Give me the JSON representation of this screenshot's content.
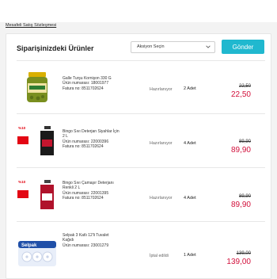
{
  "header": {
    "terms_link": "Mesafeli Satış Sözleşmesi"
  },
  "card": {
    "title": "Siparişinizdeki Ürünler",
    "action_select": {
      "value": "Aksiyon Seçin"
    },
    "send_button": "Gönder"
  },
  "items": [
    {
      "name": "Galle Turşu Kornişon 330 G",
      "product_number": "Ürün numarası: 18001977",
      "invoice_number": "Fatura no: 8511702624",
      "status": "Hazırlanıyor",
      "quantity": "2 Adet",
      "old_price": "22,50",
      "price": "22,50",
      "thumb_icon": "pickle-jar-icon"
    },
    {
      "name": "Bingo Sıvı Deterjan Siyahlar İçin 2 L",
      "product_number": "Ürün numarası: 22000396",
      "invoice_number": "Fatura no: 8511702624",
      "status": "Hazırlanıyor",
      "quantity": "4 Adet",
      "old_price": "89,90",
      "price": "89,90",
      "thumb_icon": "detergent-bottle-icon"
    },
    {
      "name": "Bingo Sıvı Çamaşır Deterjanı Renkli 2 L",
      "product_number": "Ürün numarası: 22001395",
      "invoice_number": "Fatura no: 8511702624",
      "status": "Hazırlanıyor",
      "quantity": "4 Adet",
      "old_price": "89,90",
      "price": "89,90",
      "thumb_icon": "detergent-bottle-icon"
    },
    {
      "name": "Selpak 3 Katlı 12'li Tuvalet Kağıdı",
      "product_number": "Ürün numarası: 23001279",
      "invoice_number": "",
      "status": "İptal edildi",
      "quantity": "1 Adet",
      "old_price": "139,00",
      "price": "139,00",
      "thumb_icon": "toilet-paper-pack-icon"
    }
  ],
  "colors": {
    "accent": "#20b8cf",
    "price": "#d2113c",
    "promo": "#e30613"
  }
}
